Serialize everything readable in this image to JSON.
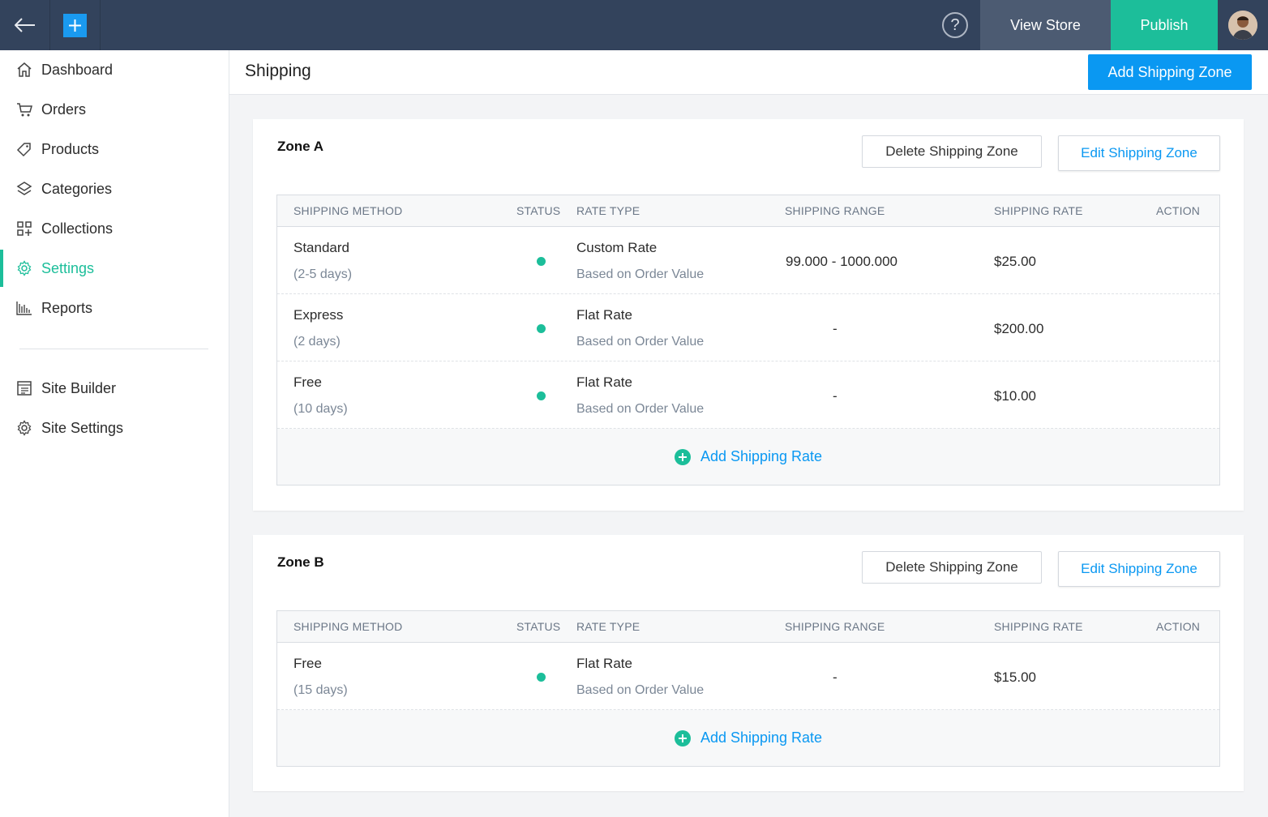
{
  "topbar": {
    "help_label": "?",
    "view_store_label": "View Store",
    "publish_label": "Publish"
  },
  "sidebar": {
    "items": [
      {
        "label": "Dashboard",
        "icon": "home-icon"
      },
      {
        "label": "Orders",
        "icon": "cart-icon"
      },
      {
        "label": "Products",
        "icon": "tag-icon"
      },
      {
        "label": "Categories",
        "icon": "layers-icon"
      },
      {
        "label": "Collections",
        "icon": "grid-icon"
      },
      {
        "label": "Settings",
        "icon": "gear-icon",
        "active": true
      },
      {
        "label": "Reports",
        "icon": "bar-chart-icon"
      }
    ],
    "secondary_items": [
      {
        "label": "Site Builder",
        "icon": "layout-icon"
      },
      {
        "label": "Site Settings",
        "icon": "gear-icon"
      }
    ]
  },
  "header": {
    "title": "Shipping",
    "add_zone_label": "Add Shipping Zone"
  },
  "table_headers": {
    "method": "SHIPPING METHOD",
    "status": "STATUS",
    "rate_type": "RATE TYPE",
    "range": "SHIPPING RANGE",
    "rate": "SHIPPING RATE",
    "action": "ACTION"
  },
  "zones": [
    {
      "name": "Zone A",
      "delete_label": "Delete Shipping Zone",
      "edit_label": "Edit Shipping Zone",
      "add_rate_label": "Add Shipping Rate",
      "rates": [
        {
          "method": "Standard",
          "duration": "(2-5 days)",
          "rate_type": "Custom Rate",
          "rate_basis": "Based on Order Value",
          "range": "99.000 - 1000.000",
          "rate": "$25.00"
        },
        {
          "method": "Express",
          "duration": "(2 days)",
          "rate_type": "Flat Rate",
          "rate_basis": "Based on Order Value",
          "range": "-",
          "rate": "$200.00"
        },
        {
          "method": "Free",
          "duration": "(10 days)",
          "rate_type": "Flat Rate",
          "rate_basis": "Based on Order Value",
          "range": "-",
          "rate": "$10.00"
        }
      ]
    },
    {
      "name": "Zone B",
      "delete_label": "Delete Shipping Zone",
      "edit_label": "Edit Shipping Zone",
      "add_rate_label": "Add Shipping Rate",
      "rates": [
        {
          "method": "Free",
          "duration": "(15 days)",
          "rate_type": "Flat Rate",
          "rate_basis": "Based on Order Value",
          "range": "-",
          "rate": "$15.00"
        }
      ]
    }
  ],
  "colors": {
    "topbar": "#33435c",
    "accent_green": "#1cbe9a",
    "accent_blue": "#0a98f2"
  }
}
